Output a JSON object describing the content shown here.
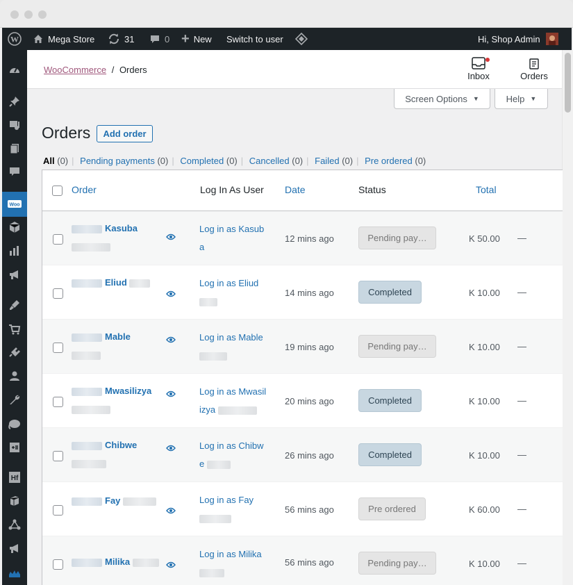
{
  "adminbar": {
    "site_name": "Mega Store",
    "updates_count": "31",
    "comments_count": "0",
    "new_label": "New",
    "switch_user_label": "Switch to user",
    "greeting": "Hi, Shop Admin"
  },
  "header": {
    "breadcrumb_root": "WooCommerce",
    "breadcrumb_sep": "/",
    "breadcrumb_current": "Orders",
    "inbox_label": "Inbox",
    "orders_label": "Orders"
  },
  "screen_options": {
    "screen_options_label": "Screen Options",
    "help_label": "Help"
  },
  "page": {
    "title": "Orders",
    "add_order_label": "Add order"
  },
  "filters": [
    {
      "label": "All",
      "count": "(0)"
    },
    {
      "label": "Pending payments",
      "count": "(0)"
    },
    {
      "label": "Completed",
      "count": "(0)"
    },
    {
      "label": "Cancelled",
      "count": "(0)"
    },
    {
      "label": "Failed",
      "count": "(0)"
    },
    {
      "label": "Pre ordered",
      "count": "(0)"
    }
  ],
  "table": {
    "columns": {
      "order": "Order",
      "login": "Log In As User",
      "date": "Date",
      "status": "Status",
      "total": "Total"
    },
    "rows": [
      {
        "name": "Kasuba",
        "login": "Log in as Kasuba",
        "date": "12 mins ago",
        "status": "Pending pay…",
        "status_type": "pending",
        "total": "K 50.00",
        "dash": "—"
      },
      {
        "name": "Eliud",
        "login": "Log in as Eliud",
        "date": "14 mins ago",
        "status": "Completed",
        "status_type": "completed",
        "total": "K 10.00",
        "dash": "—"
      },
      {
        "name": "Mable",
        "login": "Log in as Mable",
        "date": "19 mins ago",
        "status": "Pending pay…",
        "status_type": "pending",
        "total": "K 10.00",
        "dash": "—"
      },
      {
        "name": "Mwasilizya",
        "login": "Log in as Mwasilizya",
        "date": "20 mins ago",
        "status": "Completed",
        "status_type": "completed",
        "total": "K 10.00",
        "dash": "—"
      },
      {
        "name": "Chibwe",
        "login": "Log in as Chibwe",
        "date": "26 mins ago",
        "status": "Completed",
        "status_type": "completed",
        "total": "K 10.00",
        "dash": "—"
      },
      {
        "name": "Fay",
        "login": "Log in as Fay",
        "date": "56 mins ago",
        "status": "Pre ordered",
        "status_type": "pre",
        "total": "K 60.00",
        "dash": "—"
      },
      {
        "name": "Milika",
        "login": "Log in as Milika",
        "date": "56 mins ago",
        "status": "Pending pay…",
        "status_type": "pending",
        "total": "K 10.00",
        "dash": "—"
      }
    ]
  },
  "sidebar_icons": [
    "dashboard-icon",
    "pin-icon",
    "media-icon",
    "pages-icon",
    "comments-icon",
    "woocommerce-icon",
    "products-icon",
    "analytics-icon",
    "marketing-icon",
    "appearance-icon",
    "cart-icon",
    "plugins-icon",
    "users-icon",
    "tools-icon",
    "elephant-icon",
    "settings-icon",
    "hf-icon",
    "box-icon",
    "network-icon",
    "megaphone-icon",
    "collapse-icon"
  ]
}
